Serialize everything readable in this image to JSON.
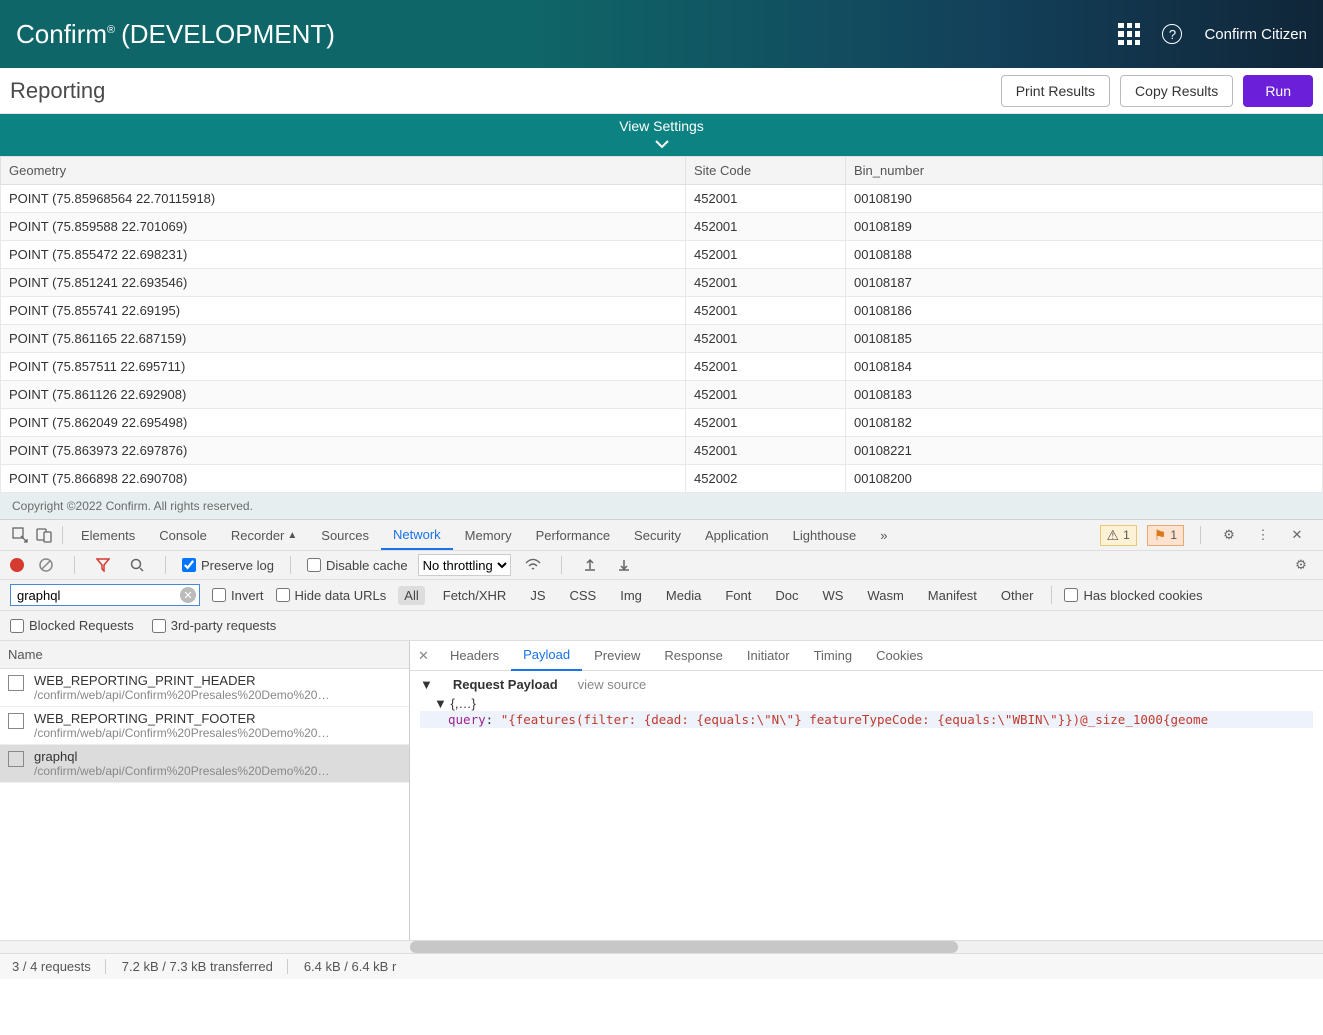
{
  "header": {
    "brand_name": "Confirm",
    "brand_reg": "®",
    "env_label": "(DEVELOPMENT)",
    "help_glyph": "?",
    "user_label": "Confirm Citizen"
  },
  "report": {
    "page_title": "Reporting",
    "print_label": "Print Results",
    "copy_label": "Copy Results",
    "run_label": "Run"
  },
  "view_settings": {
    "label": "View Settings",
    "chevron": "⌄"
  },
  "columns": {
    "geometry": "Geometry",
    "site_code": "Site Code",
    "bin_number": "Bin_number"
  },
  "rows": [
    {
      "geometry": "POINT (75.85968564 22.70115918)",
      "site": "452001",
      "bin": "00108190"
    },
    {
      "geometry": "POINT (75.859588 22.701069)",
      "site": "452001",
      "bin": "00108189"
    },
    {
      "geometry": "POINT (75.855472 22.698231)",
      "site": "452001",
      "bin": "00108188"
    },
    {
      "geometry": "POINT (75.851241 22.693546)",
      "site": "452001",
      "bin": "00108187"
    },
    {
      "geometry": "POINT (75.855741 22.69195)",
      "site": "452001",
      "bin": "00108186"
    },
    {
      "geometry": "POINT (75.861165 22.687159)",
      "site": "452001",
      "bin": "00108185"
    },
    {
      "geometry": "POINT (75.857511 22.695711)",
      "site": "452001",
      "bin": "00108184"
    },
    {
      "geometry": "POINT (75.861126 22.692908)",
      "site": "452001",
      "bin": "00108183"
    },
    {
      "geometry": "POINT (75.862049 22.695498)",
      "site": "452001",
      "bin": "00108182"
    },
    {
      "geometry": "POINT (75.863973 22.697876)",
      "site": "452001",
      "bin": "00108221"
    },
    {
      "geometry": "POINT (75.866898 22.690708)",
      "site": "452002",
      "bin": "00108200"
    }
  ],
  "footer": {
    "copyright": "Copyright ©2022 Confirm. All rights reserved."
  },
  "devtools": {
    "tabs": {
      "elements": "Elements",
      "console": "Console",
      "recorder": "Recorder",
      "sources": "Sources",
      "network": "Network",
      "memory": "Memory",
      "performance": "Performance",
      "security": "Security",
      "application": "Application",
      "lighthouse": "Lighthouse",
      "more": "»"
    },
    "warn_count": "1",
    "error_count": "1",
    "row2": {
      "preserve_log": "Preserve log",
      "disable_cache": "Disable cache",
      "no_throttling": "No throttling"
    },
    "row3": {
      "filter_value": "graphql",
      "invert": "Invert",
      "hide_data_urls": "Hide data URLs",
      "types": {
        "all": "All",
        "fetch": "Fetch/XHR",
        "js": "JS",
        "css": "CSS",
        "img": "Img",
        "media": "Media",
        "font": "Font",
        "doc": "Doc",
        "ws": "WS",
        "wasm": "Wasm",
        "manifest": "Manifest",
        "other": "Other"
      },
      "has_blocked": "Has blocked cookies"
    },
    "row4": {
      "blocked": "Blocked Requests",
      "third_party": "3rd-party requests"
    },
    "left": {
      "name_header": "Name",
      "items": [
        {
          "name": "WEB_REPORTING_PRINT_HEADER",
          "url": "/confirm/web/api/Confirm%20Presales%20Demo%20…"
        },
        {
          "name": "WEB_REPORTING_PRINT_FOOTER",
          "url": "/confirm/web/api/Confirm%20Presales%20Demo%20…"
        },
        {
          "name": "graphql",
          "url": "/confirm/web/api/Confirm%20Presales%20Demo%20…"
        }
      ]
    },
    "right": {
      "subtabs": {
        "headers": "Headers",
        "payload": "Payload",
        "preview": "Preview",
        "response": "Response",
        "initiator": "Initiator",
        "timing": "Timing",
        "cookies": "Cookies"
      },
      "request_payload": "Request Payload",
      "view_source": "view source",
      "tree_root": "{,…}",
      "query_key": "query",
      "query_value": "\"{features(filter: {dead: {equals:\\\"N\\\"} featureTypeCode: {equals:\\\"WBIN\\\"}})@_size_1000{geome"
    },
    "status": {
      "requests": "3 / 4 requests",
      "transferred": "7.2 kB / 7.3 kB transferred",
      "resources": "6.4 kB / 6.4 kB r"
    }
  }
}
